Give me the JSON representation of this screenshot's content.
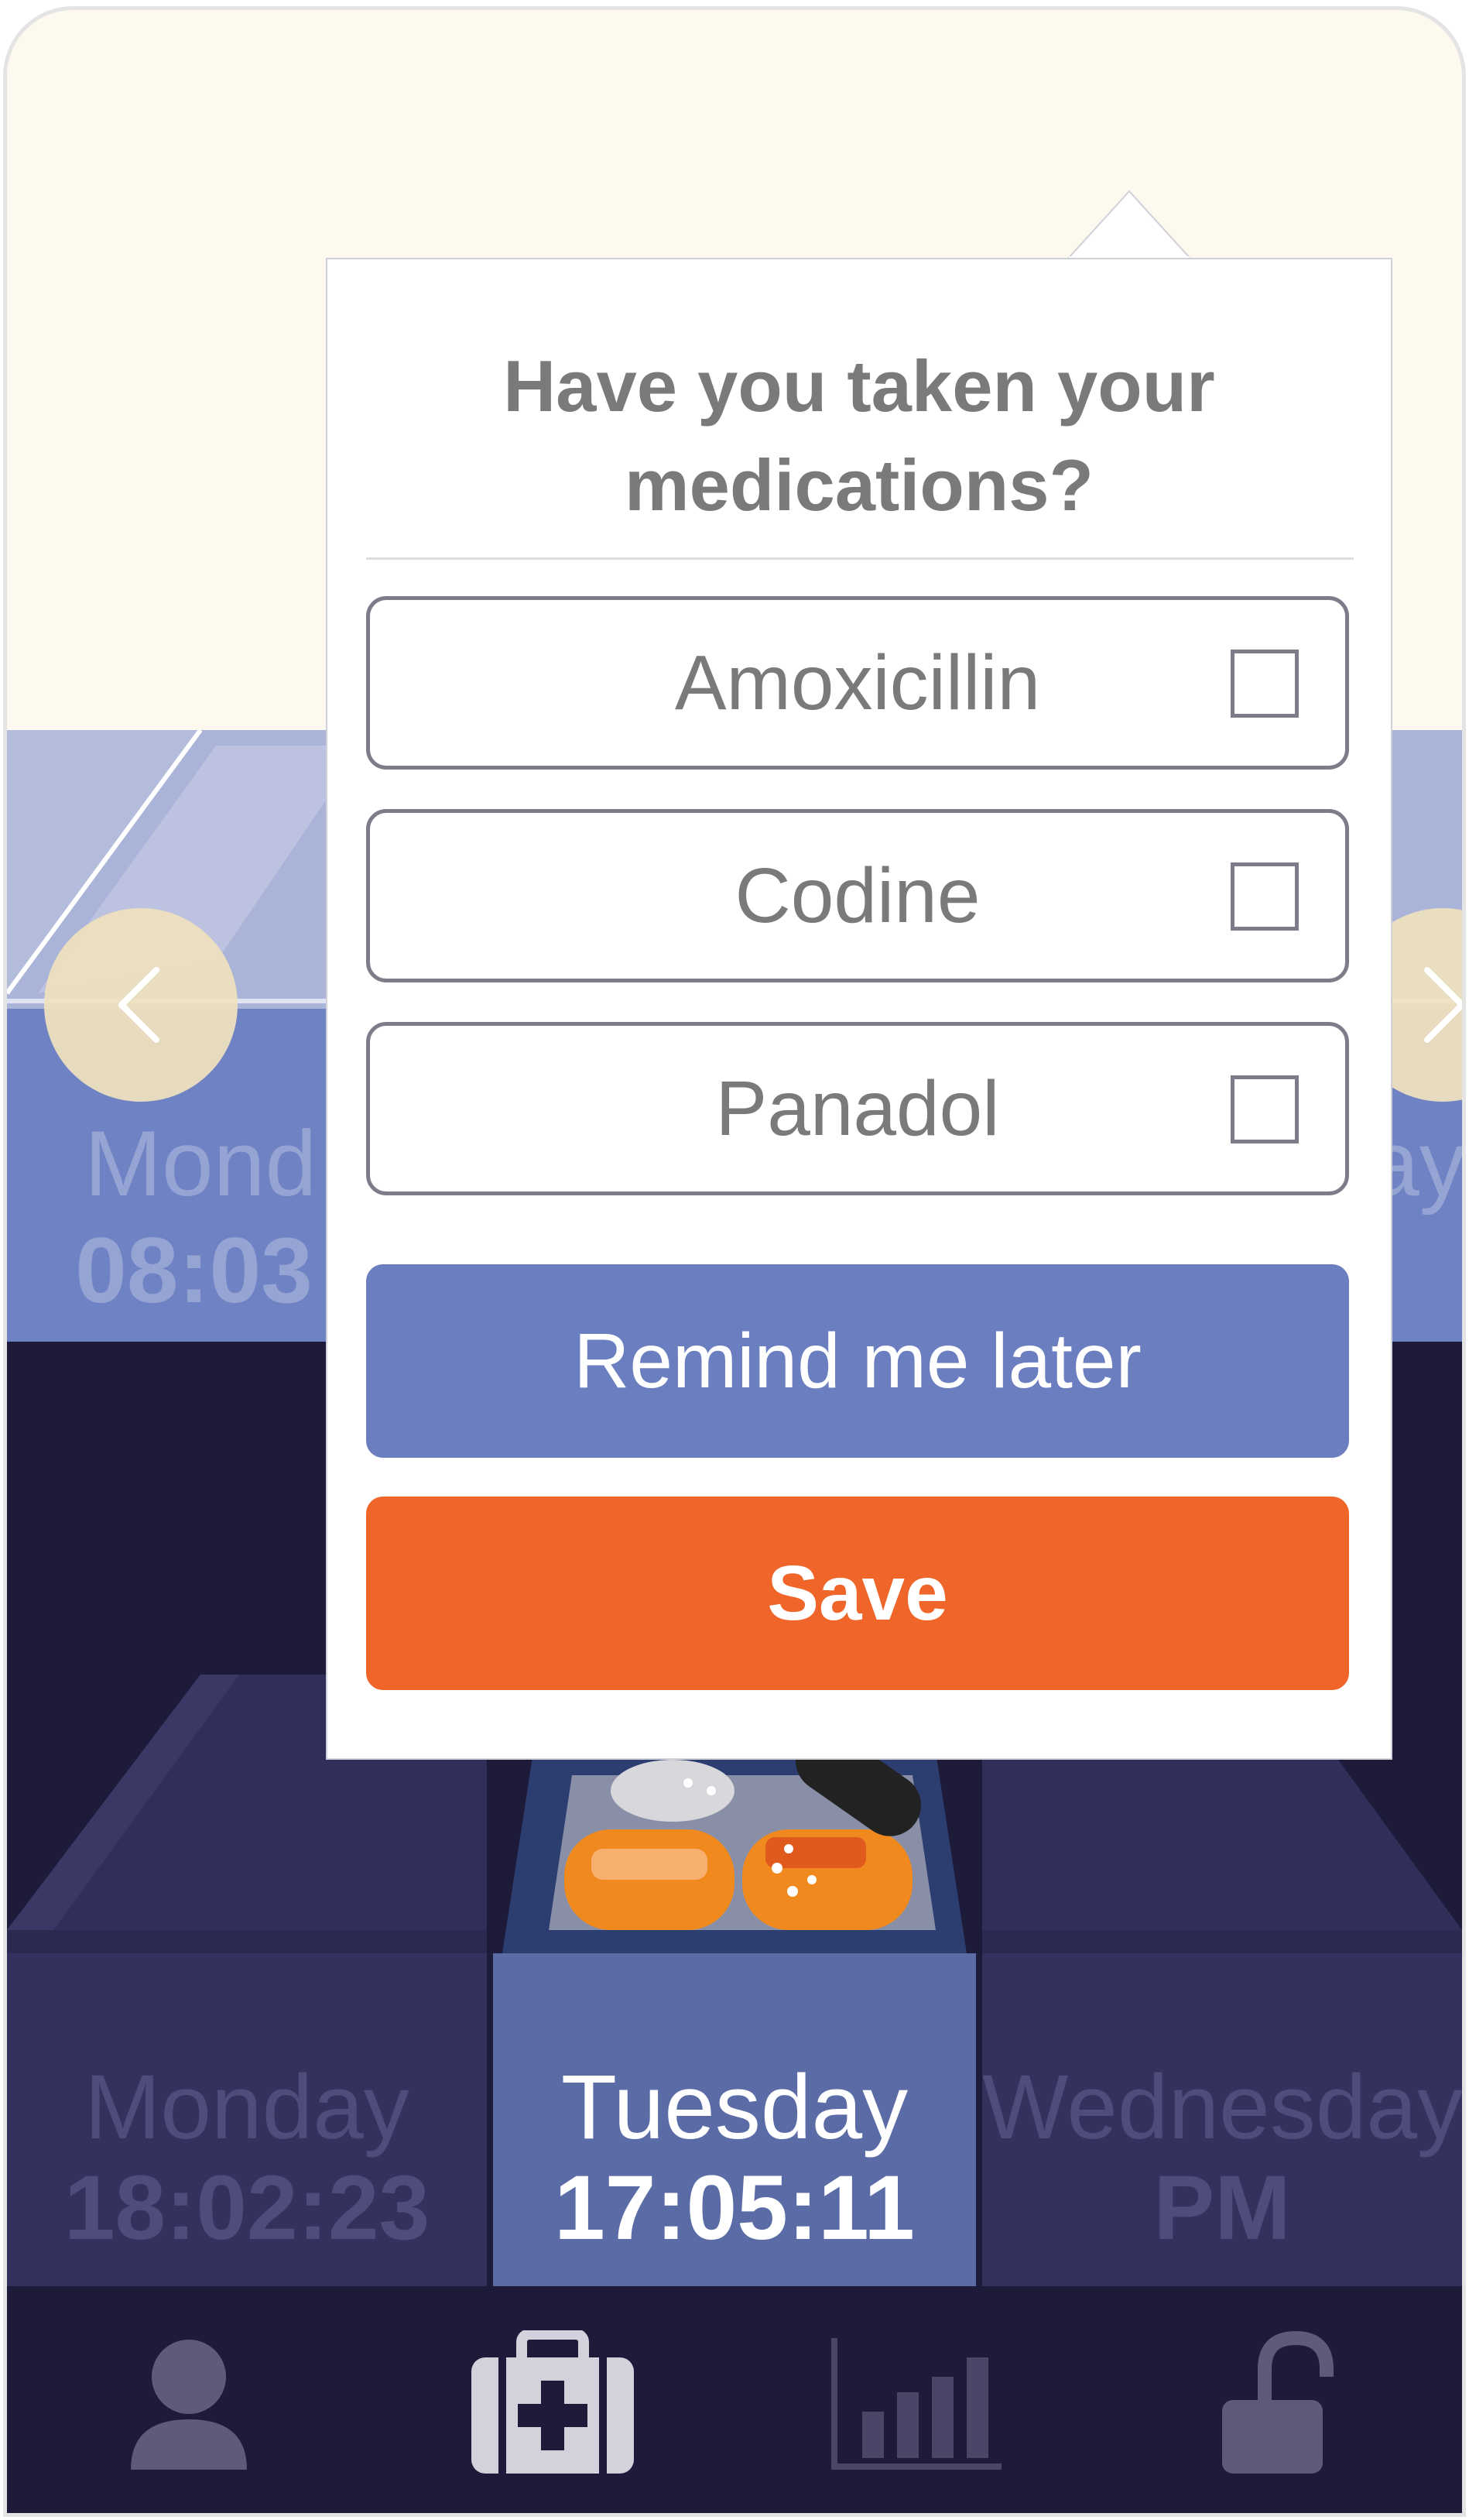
{
  "colors": {
    "background_top": "#fdf9ee",
    "pillbox_blue": "#6e82c4",
    "pillbox_dark": "#1e1a3a",
    "active_day": "#5b6ba6",
    "primary_button": "#6b7ec0",
    "save_button": "#f06529"
  },
  "top_strip": {
    "left_day": "Mond",
    "left_time": "08:03",
    "right_day": "ay"
  },
  "days": [
    {
      "name": "Monday",
      "time": "18:02:23",
      "active": false
    },
    {
      "name": "Tuesday",
      "time": "17:05:11",
      "active": true
    },
    {
      "name": "Wednesday",
      "time": "PM",
      "active": false
    }
  ],
  "modal": {
    "title_line1": "Have you taken your",
    "title_line2": "medications?",
    "medications": [
      {
        "name": "Amoxicillin",
        "checked": false
      },
      {
        "name": "Codine",
        "checked": false
      },
      {
        "name": "Panadol",
        "checked": false
      }
    ],
    "remind_label": "Remind me later",
    "save_label": "Save"
  },
  "nav": {
    "tabs": [
      {
        "icon": "profile-icon",
        "active": false
      },
      {
        "icon": "medical-kit-icon",
        "active": true
      },
      {
        "icon": "bar-chart-icon",
        "active": false
      },
      {
        "icon": "unlock-icon",
        "active": false
      }
    ]
  }
}
